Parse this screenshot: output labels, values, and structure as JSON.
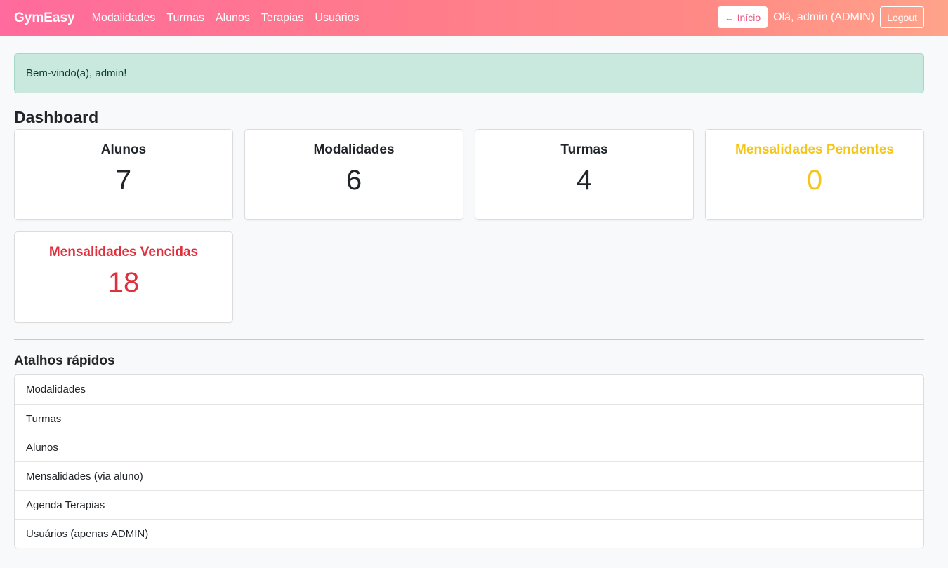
{
  "navbar": {
    "brand": "GymEasy",
    "links": [
      "Modalidades",
      "Turmas",
      "Alunos",
      "Terapias",
      "Usuários"
    ],
    "inicio_button": "← Início",
    "greeting": "Olá, admin (ADMIN)",
    "logout_button": "Logout"
  },
  "alert": {
    "message": "Bem-vindo(a), admin!"
  },
  "dashboard": {
    "title": "Dashboard",
    "cards": [
      {
        "title": "Alunos",
        "value": "7"
      },
      {
        "title": "Modalidades",
        "value": "6"
      },
      {
        "title": "Turmas",
        "value": "4"
      },
      {
        "title": "Mensalidades Pendentes",
        "value": "0"
      },
      {
        "title": "Mensalidades Vencidas",
        "value": "18"
      }
    ]
  },
  "shortcuts": {
    "title": "Atalhos rápidos",
    "items": [
      "Modalidades",
      "Turmas",
      "Alunos",
      "Mensalidades (via aluno)",
      "Agenda Terapias",
      "Usuários (apenas ADMIN)"
    ]
  },
  "colors": {
    "navbar_start": "#ff6b9d",
    "navbar_end": "#ffa38a",
    "warning": "#f5c518",
    "danger": "#e0303e",
    "alert_bg": "#c9e9df"
  }
}
